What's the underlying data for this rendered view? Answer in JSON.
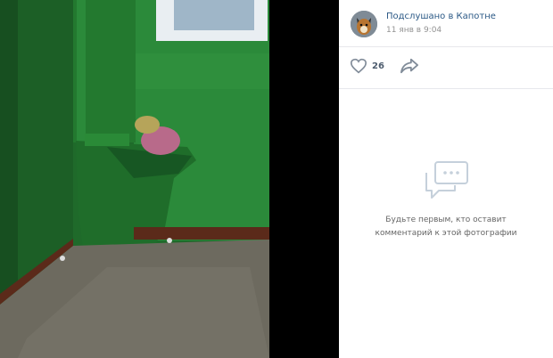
{
  "post": {
    "author": "Подслушано в Капотне",
    "date": "11 янв в 9:04",
    "likes": "26"
  },
  "comments": {
    "empty_line1": "Будьте первым, кто оставит",
    "empty_line2": "комментарий к этой фотографии"
  },
  "icons": {
    "like": "heart-icon",
    "share": "share-arrow-icon",
    "empty": "speech-bubbles-icon"
  },
  "colors": {
    "link": "#2a5885",
    "muted": "#939393",
    "wall": "#2e7d32"
  }
}
